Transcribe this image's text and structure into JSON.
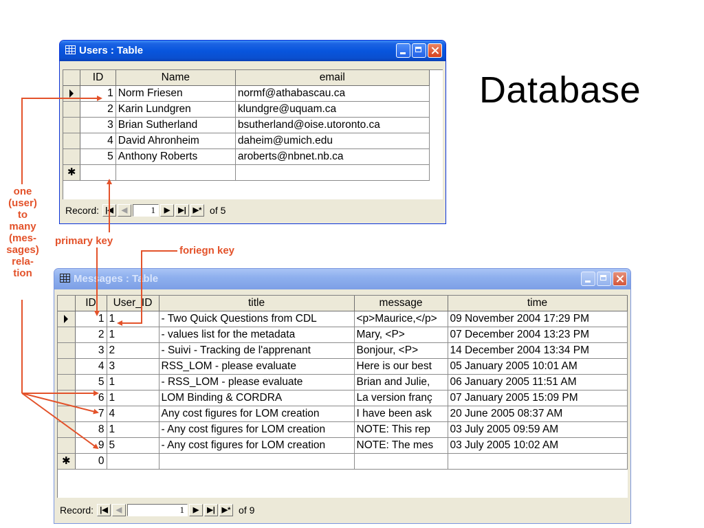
{
  "slide": {
    "title": "Database"
  },
  "users": {
    "window_title": "Users : Table",
    "columns": [
      "ID",
      "Name",
      "email"
    ],
    "rows": [
      {
        "selector": "current",
        "id": "1",
        "name": "Norm Friesen",
        "email": "normf@athabascau.ca"
      },
      {
        "selector": "",
        "id": "2",
        "name": "Karin Lundgren",
        "email": "klundgre@uquam.ca"
      },
      {
        "selector": "",
        "id": "3",
        "name": "Brian Sutherland",
        "email": "bsutherland@oise.utoronto.ca"
      },
      {
        "selector": "",
        "id": "4",
        "name": "David Ahronheim",
        "email": "daheim@umich.edu"
      },
      {
        "selector": "",
        "id": "5",
        "name": "Anthony Roberts",
        "email": "aroberts@nbnet.nb.ca"
      },
      {
        "selector": "new",
        "id": "",
        "name": "",
        "email": ""
      }
    ],
    "nav": {
      "label": "Record:",
      "current": "1",
      "of_text": "of 5"
    }
  },
  "messages": {
    "window_title": "Messages : Table",
    "columns": [
      "ID",
      "User_ID",
      "title",
      "message",
      "time"
    ],
    "rows": [
      {
        "selector": "current",
        "id": "1",
        "user_id": "1",
        "title": "- Two Quick Questions from CDL",
        "message": "<p>Maurice,</p>",
        "time": "09 November 2004 17:29 PM"
      },
      {
        "selector": "",
        "id": "2",
        "user_id": "1",
        "title": "- values list for the metadata",
        "message": "Mary,     <P>",
        "time": "07 December 2004 13:23 PM"
      },
      {
        "selector": "",
        "id": "3",
        "user_id": "2",
        "title": "- Suivi - Tracking de l'apprenant",
        "message": "Bonjour,     <P>",
        "time": "14 December 2004 13:34 PM"
      },
      {
        "selector": "",
        "id": "4",
        "user_id": "3",
        "title": "RSS_LOM - please evaluate",
        "message": "Here is our best",
        "time": "05 January 2005 10:01 AM"
      },
      {
        "selector": "",
        "id": "5",
        "user_id": "1",
        "title": "- RSS_LOM - please evaluate",
        "message": "Brian and Julie,",
        "time": "06 January 2005 11:51 AM"
      },
      {
        "selector": "",
        "id": "6",
        "user_id": "1",
        "title": "LOM Binding & CORDRA",
        "message": "La version franç",
        "time": "07 January 2005 15:09 PM"
      },
      {
        "selector": "",
        "id": "7",
        "user_id": "4",
        "title": "Any cost figures for LOM creation",
        "message": "I have been ask",
        "time": "20 June 2005 08:37 AM"
      },
      {
        "selector": "",
        "id": "8",
        "user_id": "1",
        "title": "- Any cost figures for LOM creation",
        "message": "NOTE: This rep",
        "time": "03 July 2005 09:59 AM"
      },
      {
        "selector": "",
        "id": "9",
        "user_id": "5",
        "title": "- Any cost figures for LOM creation",
        "message": "NOTE: The mes",
        "time": "03 July 2005 10:02 AM"
      },
      {
        "selector": "new",
        "id": "0",
        "user_id": "",
        "title": "",
        "message": "",
        "time": ""
      }
    ],
    "nav": {
      "label": "Record:",
      "current": "1",
      "of_text": "of 9"
    }
  },
  "annotations": {
    "relation_lines": [
      "one",
      "(user)",
      "to",
      "many",
      "(mes-",
      "sages)",
      "rela-",
      "tion"
    ],
    "primary_key": "primary key",
    "foreign_key": "foriegn key",
    "color": "#e3522a"
  },
  "nav_glyphs": {
    "first": "|◀",
    "prev": "◀",
    "next": "▶",
    "last": "▶|",
    "new": "▶*"
  },
  "new_row_glyph": "✱"
}
